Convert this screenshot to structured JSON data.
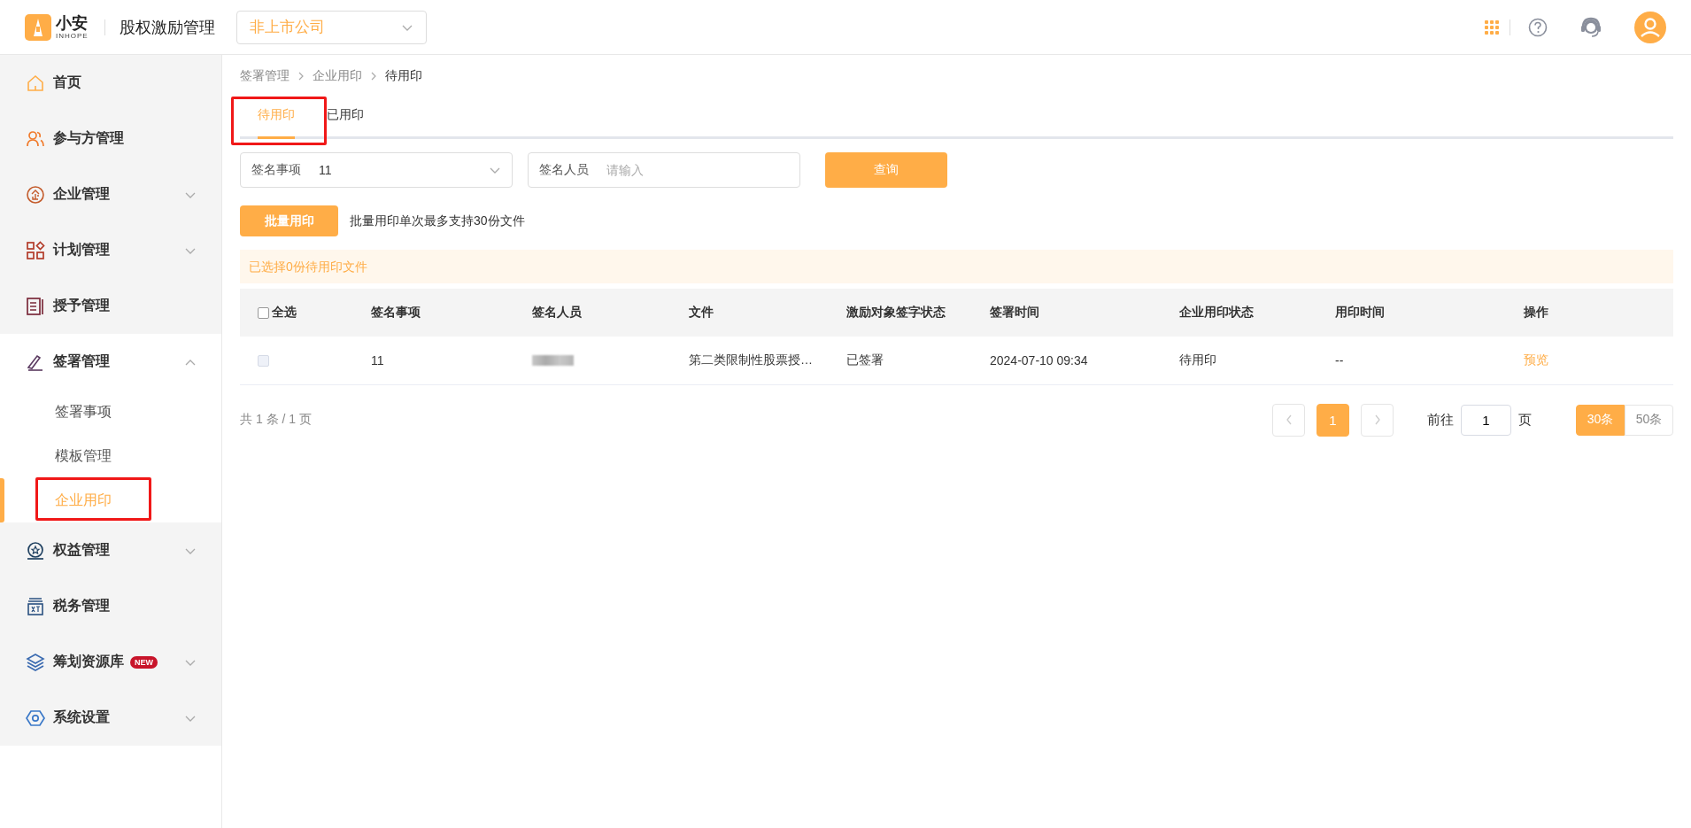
{
  "header": {
    "logo": {
      "name": "小安",
      "sub": "INHOPE"
    },
    "app_title": "股权激励管理",
    "company_select": {
      "value": "非上市公司"
    }
  },
  "sidebar": {
    "items": [
      {
        "kind": "link",
        "label": "首页"
      },
      {
        "kind": "link",
        "label": "参与方管理"
      },
      {
        "kind": "group",
        "label": "企业管理",
        "expanded": false
      },
      {
        "kind": "group",
        "label": "计划管理",
        "expanded": false
      },
      {
        "kind": "link",
        "label": "授予管理"
      },
      {
        "kind": "group",
        "label": "签署管理",
        "expanded": true,
        "children": [
          {
            "label": "签署事项",
            "selected": false,
            "highlighted": false
          },
          {
            "label": "模板管理",
            "selected": false,
            "highlighted": false
          },
          {
            "label": "企业用印",
            "selected": true,
            "highlighted": true
          }
        ]
      },
      {
        "kind": "group",
        "label": "权益管理",
        "expanded": false
      },
      {
        "kind": "link",
        "label": "税务管理"
      },
      {
        "kind": "group",
        "label": "筹划资源库",
        "expanded": false,
        "badge": "NEW"
      },
      {
        "kind": "group",
        "label": "系统设置",
        "expanded": false
      }
    ]
  },
  "breadcrumb": [
    "签署管理",
    "企业用印",
    "待用印"
  ],
  "tabs": [
    {
      "label": "待用印",
      "selected": true,
      "highlighted": true
    },
    {
      "label": "已用印",
      "selected": false,
      "highlighted": false
    }
  ],
  "filters": [
    {
      "kind": "select",
      "label": "签名事项",
      "value": "11"
    },
    {
      "kind": "input",
      "label": "签名人员",
      "placeholder": "请输入"
    }
  ],
  "query_button": "查询",
  "batch_button": "批量用印",
  "batch_note": "批量用印单次最多支持30份文件",
  "selection_info": "已选择0份待用印文件",
  "table": {
    "select_all": {
      "label": "全选",
      "checked": false
    },
    "columns": [
      "签名事项",
      "签名人员",
      "文件",
      "激励对象签字状态",
      "签署时间",
      "企业用印状态",
      "用印时间",
      "操作"
    ],
    "rows": [
      {
        "checked": false,
        "cells": [
          {
            "kind": "text",
            "text": "11"
          },
          {
            "kind": "blurred"
          },
          {
            "kind": "text",
            "text": "第二类限制性股票授…"
          },
          {
            "kind": "text",
            "text": "已签署"
          },
          {
            "kind": "text",
            "text": "2024-07-10 09:34"
          },
          {
            "kind": "text",
            "text": "待用印"
          },
          {
            "kind": "text",
            "text": "--"
          },
          {
            "kind": "link",
            "text": "预览"
          }
        ]
      }
    ]
  },
  "pagination": {
    "total": "共 1 条 / 1 页",
    "prev_disabled": true,
    "next_disabled": true,
    "pages": [
      {
        "label": "1",
        "selected": true
      }
    ],
    "goto_label": "前往",
    "goto_value": "1",
    "goto_suffix": "页",
    "sizes": [
      {
        "label": "30条",
        "selected": true
      },
      {
        "label": "50条",
        "selected": false
      }
    ]
  }
}
